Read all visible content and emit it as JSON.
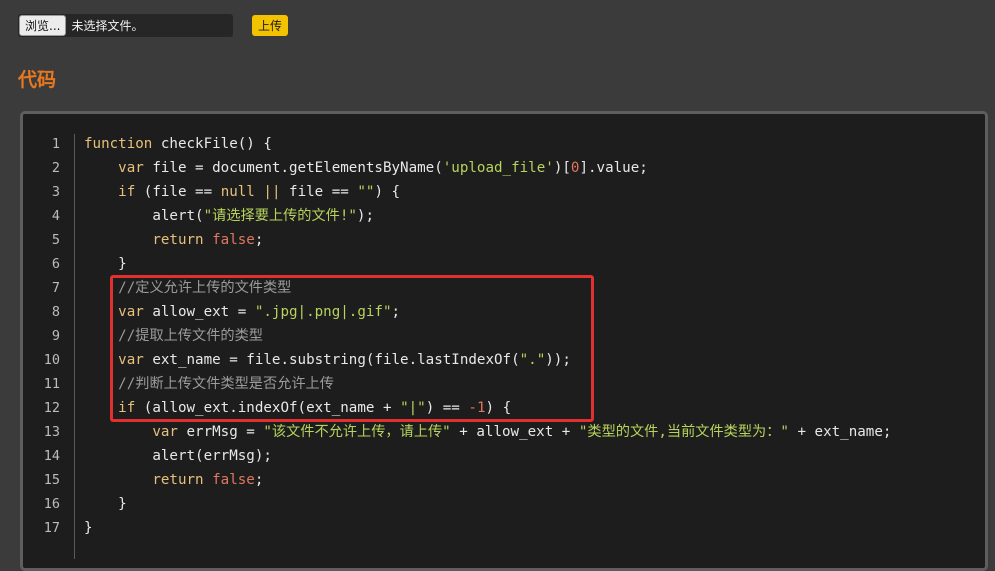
{
  "upload": {
    "browse_label": "浏览...",
    "file_status": "未选择文件。",
    "submit_label": "上传"
  },
  "section_title": "代码",
  "code_lines": [
    {
      "n": "1",
      "tokens": [
        [
          "kw",
          "function"
        ],
        [
          "p",
          " checkFile() {"
        ]
      ]
    },
    {
      "n": "2",
      "tokens": [
        [
          "p",
          "    "
        ],
        [
          "kw",
          "var"
        ],
        [
          "p",
          " file = document.getElementsByName("
        ],
        [
          "str",
          "'upload_file'"
        ],
        [
          "p",
          ")["
        ],
        [
          "num",
          "0"
        ],
        [
          "p",
          "].value;"
        ]
      ]
    },
    {
      "n": "3",
      "tokens": [
        [
          "p",
          "    "
        ],
        [
          "kw",
          "if"
        ],
        [
          "p",
          " (file == "
        ],
        [
          "kw",
          "null"
        ],
        [
          "p",
          " "
        ],
        [
          "kw",
          "||"
        ],
        [
          "p",
          " file == "
        ],
        [
          "str",
          "\"\""
        ],
        [
          "p",
          ") {"
        ]
      ]
    },
    {
      "n": "4",
      "tokens": [
        [
          "p",
          "        alert("
        ],
        [
          "str",
          "\"请选择要上传的文件!\""
        ],
        [
          "p",
          ");"
        ]
      ]
    },
    {
      "n": "5",
      "tokens": [
        [
          "p",
          "        "
        ],
        [
          "kw",
          "return"
        ],
        [
          "p",
          " "
        ],
        [
          "bool",
          "false"
        ],
        [
          "p",
          ";"
        ]
      ]
    },
    {
      "n": "6",
      "tokens": [
        [
          "p",
          "    }"
        ]
      ]
    },
    {
      "n": "7",
      "tokens": [
        [
          "p",
          "    "
        ],
        [
          "com",
          "//定义允许上传的文件类型"
        ]
      ]
    },
    {
      "n": "8",
      "tokens": [
        [
          "p",
          "    "
        ],
        [
          "kw",
          "var"
        ],
        [
          "p",
          " allow_ext = "
        ],
        [
          "str",
          "\".jpg|.png|.gif\""
        ],
        [
          "p",
          ";"
        ]
      ]
    },
    {
      "n": "9",
      "tokens": [
        [
          "p",
          "    "
        ],
        [
          "com",
          "//提取上传文件的类型"
        ]
      ]
    },
    {
      "n": "10",
      "tokens": [
        [
          "p",
          "    "
        ],
        [
          "kw",
          "var"
        ],
        [
          "p",
          " ext_name = file.substring(file.lastIndexOf("
        ],
        [
          "str",
          "\".\""
        ],
        [
          "p",
          "));"
        ]
      ]
    },
    {
      "n": "11",
      "tokens": [
        [
          "p",
          "    "
        ],
        [
          "com",
          "//判断上传文件类型是否允许上传"
        ]
      ]
    },
    {
      "n": "12",
      "tokens": [
        [
          "p",
          "    "
        ],
        [
          "kw",
          "if"
        ],
        [
          "p",
          " (allow_ext.indexOf(ext_name + "
        ],
        [
          "str",
          "\"|\""
        ],
        [
          "p",
          ") == "
        ],
        [
          "num",
          "-1"
        ],
        [
          "p",
          ") {"
        ]
      ]
    },
    {
      "n": "13",
      "tokens": [
        [
          "p",
          "        "
        ],
        [
          "kw",
          "var"
        ],
        [
          "p",
          " errMsg = "
        ],
        [
          "str",
          "\"该文件不允许上传，请上传\""
        ],
        [
          "p",
          " + allow_ext + "
        ],
        [
          "str",
          "\"类型的文件,当前文件类型为：\""
        ],
        [
          "p",
          " + ext_name;"
        ]
      ]
    },
    {
      "n": "14",
      "tokens": [
        [
          "p",
          "        alert(errMsg);"
        ]
      ]
    },
    {
      "n": "15",
      "tokens": [
        [
          "p",
          "        "
        ],
        [
          "kw",
          "return"
        ],
        [
          "p",
          " "
        ],
        [
          "bool",
          "false"
        ],
        [
          "p",
          ";"
        ]
      ]
    },
    {
      "n": "16",
      "tokens": [
        [
          "p",
          "    }"
        ]
      ]
    },
    {
      "n": "17",
      "tokens": [
        [
          "p",
          "}"
        ]
      ]
    }
  ],
  "colors": {
    "section_title": "#e8781e",
    "upload_button": "#f4c300",
    "highlight_border": "#e03030"
  }
}
